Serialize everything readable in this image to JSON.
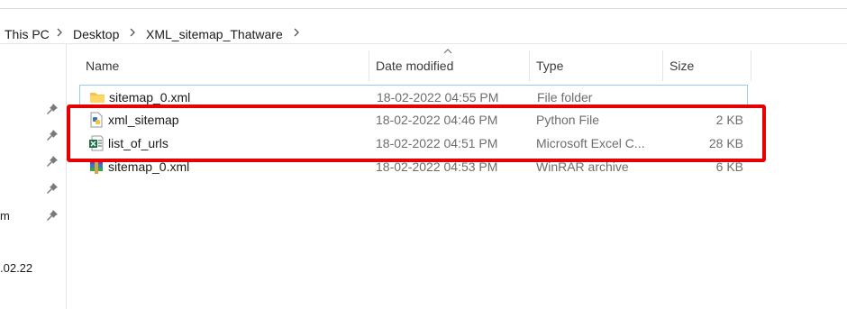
{
  "breadcrumb": {
    "items": [
      "This PC",
      "Desktop",
      "XML_sitemap_Thatware"
    ],
    "separator": ">"
  },
  "nav_pane": {
    "partial_labels": [
      "m",
      ".02.22"
    ]
  },
  "columns": {
    "name": "Name",
    "date": "Date modified",
    "type": "Type",
    "size": "Size"
  },
  "files": [
    {
      "name": "sitemap_0.xml",
      "date": "18-02-2022 04:55 PM",
      "type": "File folder",
      "size": "",
      "icon": "folder-icon"
    },
    {
      "name": "xml_sitemap",
      "date": "18-02-2022 04:46 PM",
      "type": "Python File",
      "size": "2 KB",
      "icon": "python-file-icon"
    },
    {
      "name": "list_of_urls",
      "date": "18-02-2022 04:51 PM",
      "type": "Microsoft Excel C...",
      "size": "28 KB",
      "icon": "excel-csv-icon"
    },
    {
      "name": "sitemap_0.xml",
      "date": "18-02-2022 04:53 PM",
      "type": "WinRAR archive",
      "size": "6 KB",
      "icon": "winrar-archive-icon"
    }
  ],
  "colors": {
    "highlight": "#e60000",
    "selection_outline": "#99c9ef",
    "folder": "#f5c24c"
  }
}
